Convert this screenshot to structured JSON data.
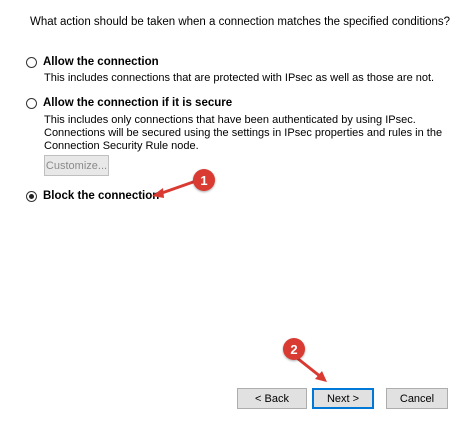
{
  "question": "What action should be taken when a connection matches the specified conditions?",
  "options": [
    {
      "label": "Allow the connection",
      "description": "This includes connections that are protected with IPsec as well as those are not.",
      "checked": false
    },
    {
      "label": "Allow the connection if it is secure",
      "description": "This includes only connections that have been authenticated by using IPsec.  Connections will be secured using the settings in IPsec properties and rules in the Connection Security Rule node.",
      "checked": false
    },
    {
      "label": "Block the connection",
      "description": "",
      "checked": true
    }
  ],
  "customize_label": "Customize...",
  "buttons": {
    "back": "< Back",
    "next": "Next >",
    "cancel": "Cancel"
  },
  "annotations": {
    "badge1": "1",
    "badge2": "2",
    "color": "#d93a32"
  }
}
